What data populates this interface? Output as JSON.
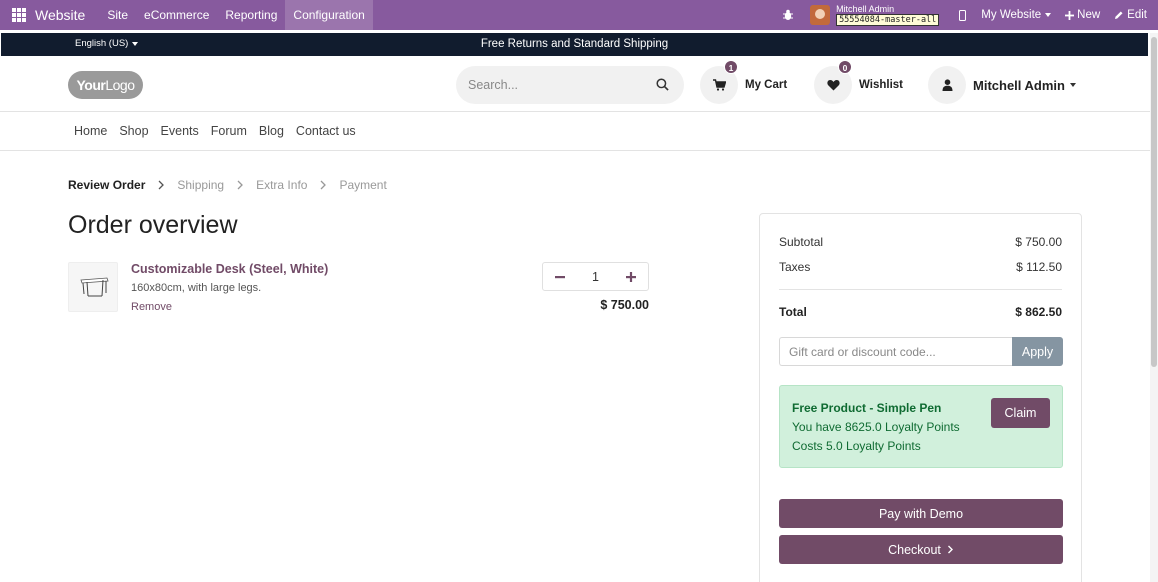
{
  "admin_bar": {
    "brand": "Website",
    "menu": [
      "Site",
      "eCommerce",
      "Reporting",
      "Configuration"
    ],
    "user_name": "Mitchell Admin",
    "db_name": "55554084-master-all",
    "website": "My Website",
    "new_label": "New",
    "edit_label": "Edit",
    "color": "#875a9e"
  },
  "announcement": {
    "language": "English (US)",
    "message": "Free Returns and Standard Shipping"
  },
  "header": {
    "logo_bold": "Your",
    "logo_light": "Logo",
    "search_placeholder": "Search...",
    "cart_label": "My Cart",
    "cart_count": "1",
    "wishlist_label": "Wishlist",
    "wishlist_count": "0",
    "user_name": "Mitchell Admin"
  },
  "nav": [
    "Home",
    "Shop",
    "Events",
    "Forum",
    "Blog",
    "Contact us"
  ],
  "wizard": {
    "steps": [
      "Review Order",
      "Shipping",
      "Extra Info",
      "Payment"
    ],
    "current": 0
  },
  "page_title": "Order overview",
  "cart_line": {
    "name": "Customizable Desk (Steel, White)",
    "description": "160x80cm, with large legs.",
    "remove_label": "Remove",
    "quantity": "1",
    "price": "$ 750.00"
  },
  "summary": {
    "subtotal_label": "Subtotal",
    "subtotal": "$ 750.00",
    "taxes_label": "Taxes",
    "taxes": "$ 112.50",
    "total_label": "Total",
    "total": "$ 862.50",
    "coupon_placeholder": "Gift card or discount code...",
    "apply_label": "Apply",
    "reward": {
      "title": "Free Product - Simple Pen",
      "have": "You have 8625.0 Loyalty Points",
      "cost": "Costs 5.0 Loyalty Points",
      "claim_label": "Claim"
    },
    "pay_demo_label": "Pay with Demo",
    "checkout_label": "Checkout"
  },
  "colors": {
    "accent": "#714b67",
    "reward_bg": "#d1f0dc",
    "reward_text": "#0f6b32",
    "announce_bg": "#111c2e"
  }
}
